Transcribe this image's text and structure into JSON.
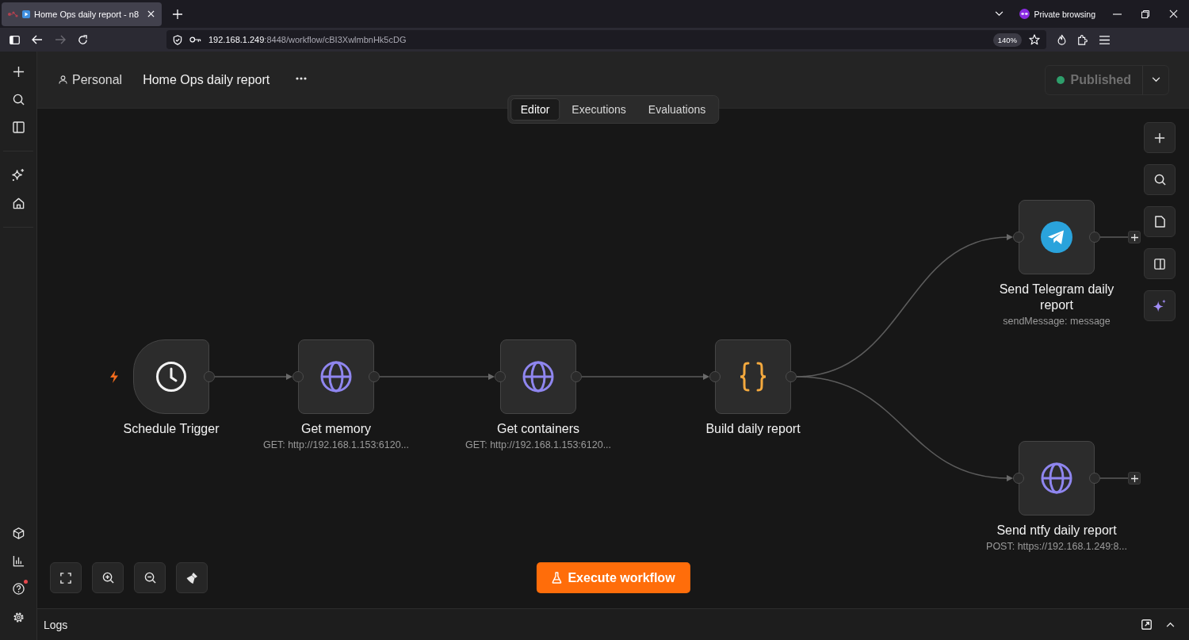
{
  "browser": {
    "tabs": [
      {
        "title": "Home Ops daily report - n8",
        "selected": true
      }
    ],
    "private_label": "Private browsing",
    "forward_disabled": true,
    "url": {
      "host": "192.168.1.249",
      "path": ":8448/workflow/cBI3XwlmbnHk5cDG"
    },
    "zoom": "140%"
  },
  "sidebar": {
    "help_notification": true
  },
  "header": {
    "project": "Personal",
    "workflow_name": "Home Ops daily report",
    "status": {
      "label": "Published",
      "published": true,
      "disabled": true
    }
  },
  "view_tabs": [
    {
      "label": "Editor",
      "selected": true
    },
    {
      "label": "Executions",
      "selected": false
    },
    {
      "label": "Evaluations",
      "selected": false
    }
  ],
  "nodes": [
    {
      "kind": "trigger",
      "name": "Schedule Trigger"
    },
    {
      "kind": "http",
      "name": "Get memory",
      "subtitle": "GET: http://192.168.1.153:6120..."
    },
    {
      "kind": "http",
      "name": "Get containers",
      "subtitle": "GET: http://192.168.1.153:6120..."
    },
    {
      "kind": "code",
      "name": "Build daily report"
    },
    {
      "kind": "telegram",
      "name": "Send Telegram daily report",
      "subtitle": "sendMessage: message"
    },
    {
      "kind": "http",
      "name": "Send ntfy daily report",
      "subtitle": "POST: https://192.168.1.249:8..."
    }
  ],
  "execute_button": "Execute workflow",
  "logs_panel": {
    "title": "Logs"
  }
}
